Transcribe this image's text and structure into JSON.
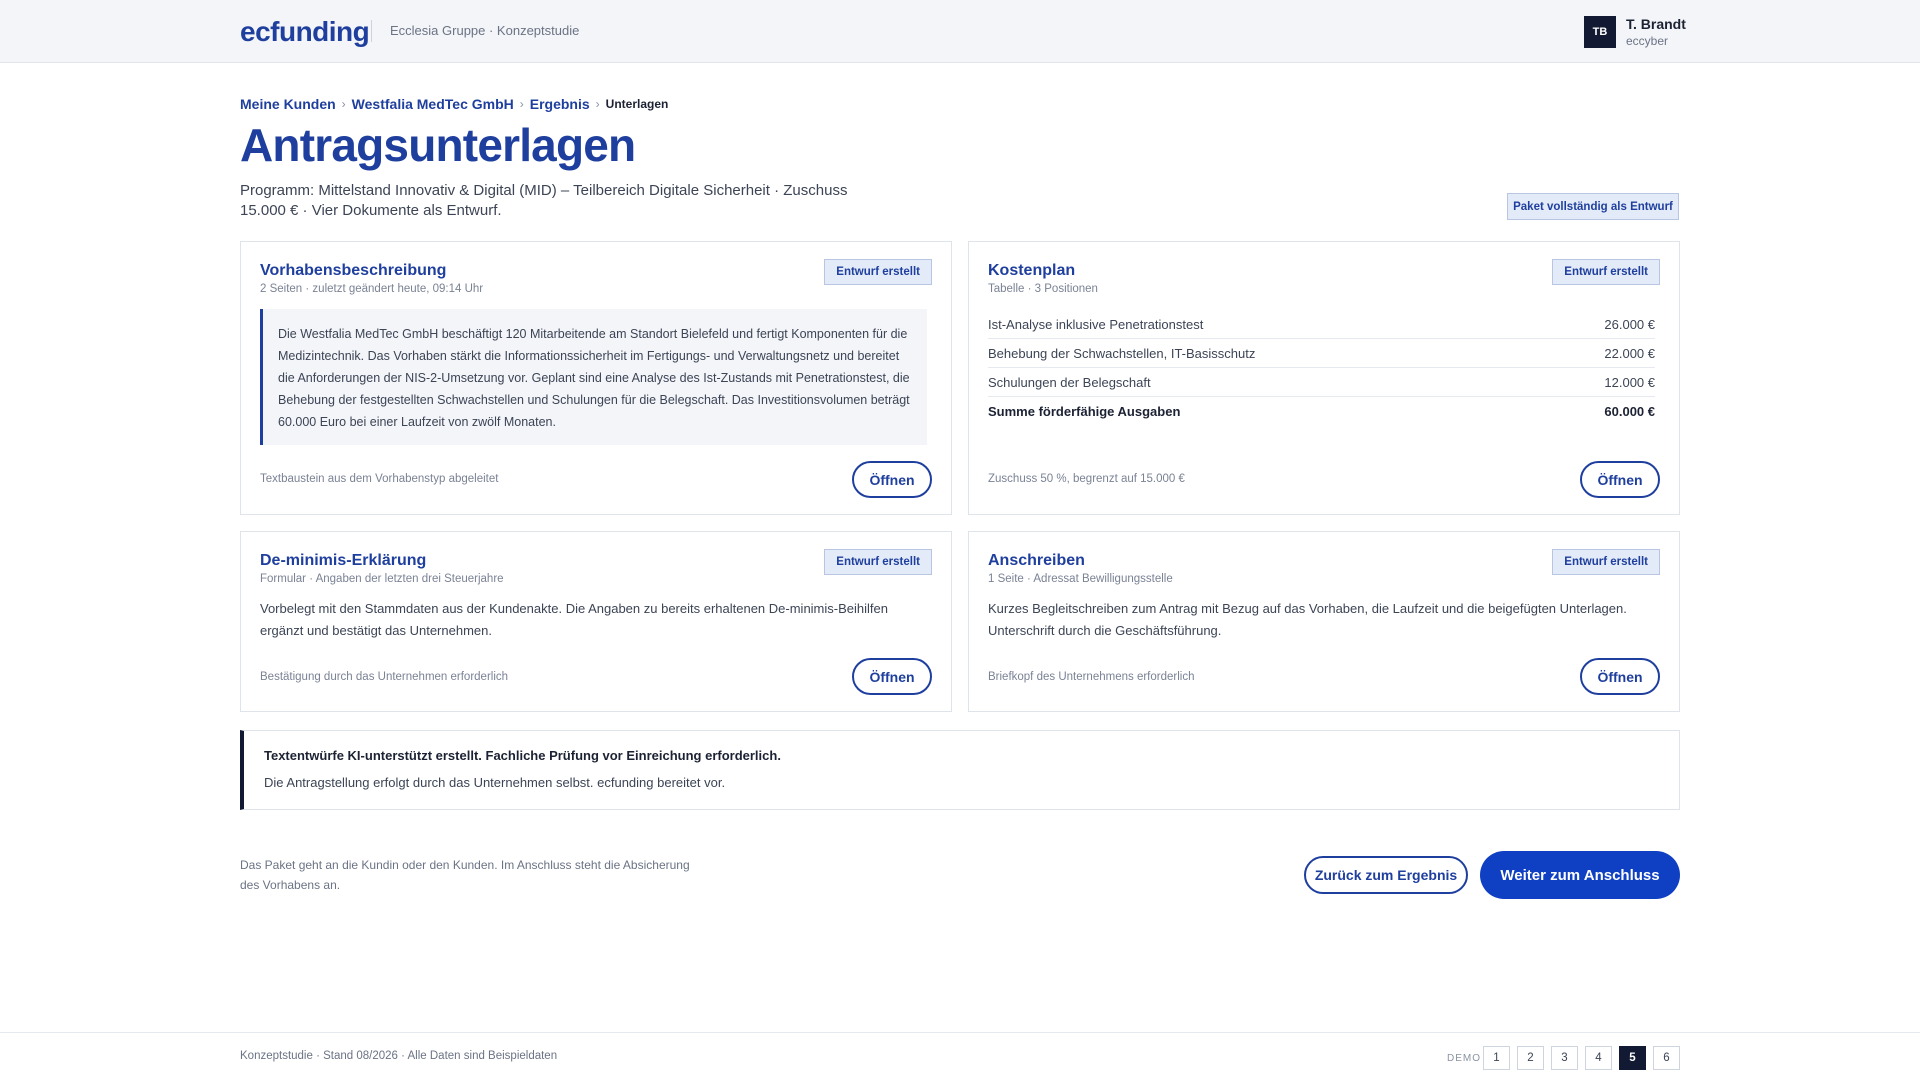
{
  "header": {
    "logo": "ecfunding",
    "subtitle": "Ecclesia Gruppe · Konzeptstudie",
    "user": {
      "initials": "TB",
      "name": "T. Brandt",
      "handle": "eccyber"
    }
  },
  "breadcrumb": {
    "items": [
      "Meine Kunden",
      "Westfalia MedTec GmbH",
      "Ergebnis"
    ],
    "current": "Unterlagen",
    "separator": "›"
  },
  "page": {
    "title": "Antragsunterlagen",
    "program": "Programm: Mittelstand Innovativ & Digital (MID) – Teilbereich Digitale Sicherheit · Zuschuss 15.000 € · Vier Dokumente als Entwurf.",
    "package_badge": "Paket vollständig als Entwurf"
  },
  "cards": {
    "vorhaben": {
      "title": "Vorhabensbeschreibung",
      "meta": "2 Seiten · zuletzt geändert heute, 09:14 Uhr",
      "status": "Entwurf erstellt",
      "quote": "Die Westfalia MedTec GmbH beschäftigt 120 Mitarbeitende am Standort Bielefeld und fertigt Komponenten für die Medizintechnik. Das Vorhaben stärkt die Informationssicherheit im Fertigungs- und Verwaltungsnetz und bereitet die Anforderungen der NIS-2-Umsetzung vor. Geplant sind eine Analyse des Ist-Zustands mit Penetrationstest, die Behebung der festgestellten Schwachstellen und Schulungen für die Belegschaft. Das Investitionsvolumen beträgt 60.000 Euro bei einer Laufzeit von zwölf Monaten.",
      "note": "Textbaustein aus dem Vorhabenstyp abgeleitet",
      "button": "Öffnen"
    },
    "kosten": {
      "title": "Kostenplan",
      "meta": "Tabelle · 3 Positionen",
      "status": "Entwurf erstellt",
      "rows": [
        {
          "label": "Ist-Analyse inklusive Penetrationstest",
          "amount": "26.000 €"
        },
        {
          "label": "Behebung der Schwachstellen, IT-Basisschutz",
          "amount": "22.000 €"
        },
        {
          "label": "Schulungen der Belegschaft",
          "amount": "12.000 €"
        }
      ],
      "total": {
        "label": "Summe förderfähige Ausgaben",
        "amount": "60.000 €"
      },
      "note": "Zuschuss 50 %, begrenzt auf 15.000 €",
      "button": "Öffnen"
    },
    "deminimis": {
      "title": "De-minimis-Erklärung",
      "meta": "Formular · Angaben der letzten drei Steuerjahre",
      "status": "Entwurf erstellt",
      "body": "Vorbelegt mit den Stammdaten aus der Kundenakte. Die Angaben zu bereits erhaltenen De-minimis-Beihilfen ergänzt und bestätigt das Unternehmen.",
      "note": "Bestätigung durch das Unternehmen erforderlich",
      "button": "Öffnen"
    },
    "anschreiben": {
      "title": "Anschreiben",
      "meta": "1 Seite · Adressat Bewilligungsstelle",
      "status": "Entwurf erstellt",
      "body": "Kurzes Begleitschreiben zum Antrag mit Bezug auf das Vorhaben, die Laufzeit und die beigefügten Unterlagen. Unterschrift durch die Geschäftsführung.",
      "note": "Briefkopf des Unternehmens erforderlich",
      "button": "Öffnen"
    }
  },
  "info": {
    "strong": "Textentwürfe KI-unterstützt erstellt. Fachliche Prüfung vor Einreichung erforderlich.",
    "text": "Die Antragstellung erfolgt durch das Unternehmen selbst. ecfunding bereitet vor."
  },
  "actions": {
    "note": "Das Paket geht an die Kundin oder den Kunden. Im Anschluss steht die Absicherung des Vorhabens an.",
    "back": "Zurück zum Ergebnis",
    "next": "Weiter zum Anschluss"
  },
  "footer": {
    "text": "Konzeptstudie · Stand 08/2026 · Alle Daten sind Beispieldaten",
    "demo_label": "DEMO",
    "pages": [
      "1",
      "2",
      "3",
      "4",
      "5",
      "6"
    ],
    "active_page": "5"
  },
  "colors": {
    "brand": "#1f3f9e",
    "primary_button": "#0f3fc2",
    "dark": "#121a33",
    "badge_bg": "#e4ebf8"
  }
}
